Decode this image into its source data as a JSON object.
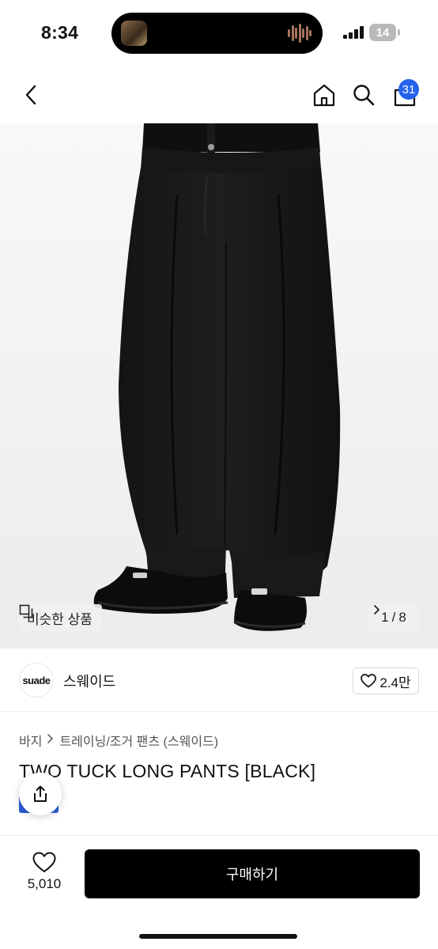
{
  "status_bar": {
    "time": "8:34",
    "battery": "14"
  },
  "nav": {
    "cart_count": "31"
  },
  "gallery": {
    "similar_label": "비슷한 상품",
    "page_current": "1",
    "page_total": "8"
  },
  "brand": {
    "logo_text": "suade",
    "name": "스웨이드",
    "likes": "2.4만"
  },
  "product": {
    "breadcrumb": [
      "바지",
      "트레이닝/조거 팬츠 (스웨이드)"
    ],
    "title": "TWO TUCK LONG PANTS [BLACK]"
  },
  "bottom_bar": {
    "wish_count": "5,010",
    "buy_label": "구매하기"
  },
  "colors": {
    "accent_blue": "#2563eb",
    "buy_button": "#000000"
  }
}
